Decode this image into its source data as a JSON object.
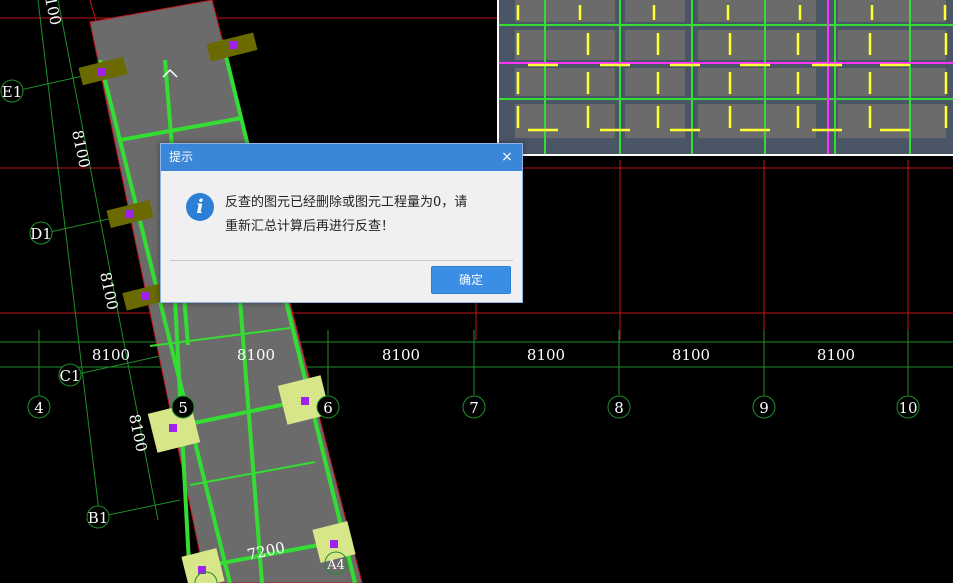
{
  "canvas": {
    "axis_spacing_labels": [
      "8100",
      "8100",
      "8100",
      "8100",
      "8100",
      "8100"
    ],
    "axis_bubbles": [
      "4",
      "5",
      "6",
      "7",
      "8",
      "9",
      "10"
    ],
    "row_bubbles": [
      "E1",
      "D1",
      "C1",
      "B1"
    ],
    "rotated_dims": [
      "100",
      "8100",
      "8100",
      "8100"
    ],
    "bottom_dim": "7200",
    "bottom_axis_partial": "A4",
    "colors": {
      "background": "#000000",
      "grid_red": "#c0141c",
      "grid_green": "#1e8f2a",
      "slab_fill": "#6b6b6b",
      "beam_green": "#33dd33",
      "column_pad": "#d8e68a",
      "column_dark": "#6a6a00",
      "column_point": "#a020f0",
      "rebar_yellow": "#ffff33",
      "rebar_magenta": "#ff33ff",
      "grid_text": "#ffffff"
    }
  },
  "dialog": {
    "title": "提示",
    "close": "×",
    "icon": "i",
    "message_line1": "反查的图元已经删除或图元工程量为0，请",
    "message_line2": "重新汇总计算后再进行反查！",
    "ok_label": "确定"
  }
}
